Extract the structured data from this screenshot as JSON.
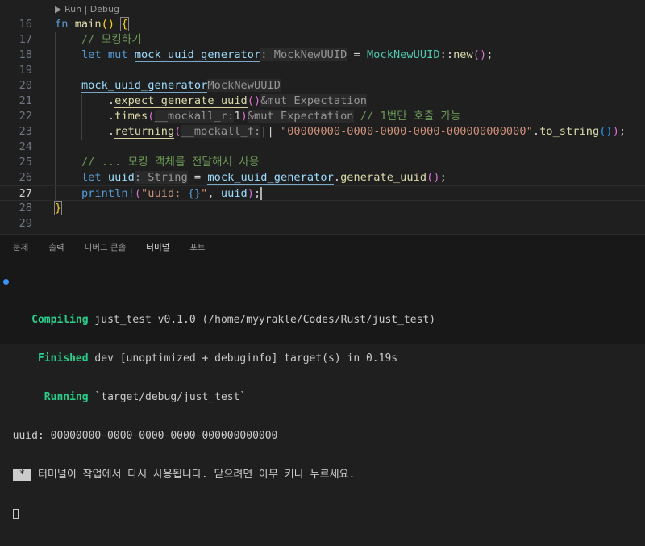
{
  "codelens": {
    "run": "Run",
    "sep": " | ",
    "debug": "Debug"
  },
  "editor": {
    "lines": [
      {
        "n": "16",
        "tokens": [
          [
            "fn ",
            "kw"
          ],
          [
            "main",
            "fn"
          ],
          [
            "()",
            "br1"
          ],
          [
            " ",
            "p"
          ],
          [
            "{",
            "br1 bb"
          ]
        ]
      },
      {
        "n": "17",
        "tokens": [
          [
            "    ",
            "p"
          ],
          [
            "// 모킹하기",
            "cm"
          ]
        ]
      },
      {
        "n": "18",
        "tokens": [
          [
            "    ",
            "p"
          ],
          [
            "let mut ",
            "kw"
          ],
          [
            "mock_uuid_generator",
            "var ul"
          ],
          [
            ": MockNewUUID",
            "hint"
          ],
          [
            " = ",
            "p"
          ],
          [
            "MockNewUUID",
            "ty"
          ],
          [
            "::",
            "p"
          ],
          [
            "new",
            "fn"
          ],
          [
            "()",
            "br2"
          ],
          [
            ";",
            "p"
          ]
        ]
      },
      {
        "n": "19",
        "tokens": []
      },
      {
        "n": "20",
        "tokens": [
          [
            "    ",
            "p"
          ],
          [
            "mock_uuid_generator",
            "var ul"
          ],
          [
            "MockNewUUID",
            "hint"
          ]
        ]
      },
      {
        "n": "21",
        "tokens": [
          [
            "        .",
            "p"
          ],
          [
            "expect_generate_uuid",
            "fn ulm"
          ],
          [
            "()",
            "br2"
          ],
          [
            "&mut Expectation",
            "hint"
          ]
        ]
      },
      {
        "n": "22",
        "tokens": [
          [
            "        .",
            "p"
          ],
          [
            "times",
            "fn ulm"
          ],
          [
            "(",
            "br2"
          ],
          [
            "__mockall_r:",
            "hint"
          ],
          [
            "1",
            "p"
          ],
          [
            ")",
            "br2"
          ],
          [
            "&mut Expectation",
            "hint"
          ],
          [
            " // 1번만 호출 가능",
            "cm"
          ]
        ]
      },
      {
        "n": "23",
        "tokens": [
          [
            "        .",
            "p"
          ],
          [
            "returning",
            "fn ulm"
          ],
          [
            "(",
            "br2"
          ],
          [
            "__mockall_f:",
            "hint"
          ],
          [
            "|| ",
            "p"
          ],
          [
            "\"00000000-0000-0000-0000-000000000000\"",
            "str"
          ],
          [
            ".",
            "p"
          ],
          [
            "to_string",
            "fn"
          ],
          [
            "()",
            "br3"
          ],
          [
            ")",
            "br2"
          ],
          [
            ";",
            "p"
          ]
        ]
      },
      {
        "n": "24",
        "tokens": []
      },
      {
        "n": "25",
        "tokens": [
          [
            "    ",
            "p"
          ],
          [
            "// ... 모킹 객체를 전달해서 사용",
            "cm"
          ]
        ]
      },
      {
        "n": "26",
        "tokens": [
          [
            "    ",
            "p"
          ],
          [
            "let ",
            "kw"
          ],
          [
            "uuid",
            "var"
          ],
          [
            ": String",
            "hint"
          ],
          [
            " = ",
            "p"
          ],
          [
            "mock_uuid_generator",
            "var ul"
          ],
          [
            ".",
            "p"
          ],
          [
            "generate_uuid",
            "fn"
          ],
          [
            "()",
            "br2"
          ],
          [
            ";",
            "p"
          ]
        ]
      },
      {
        "n": "27",
        "tokens": [
          [
            "    ",
            "p"
          ],
          [
            "println!",
            "kw"
          ],
          [
            "(",
            "br2"
          ],
          [
            "\"uuid: ",
            "str"
          ],
          [
            "{}",
            "kw"
          ],
          [
            "\"",
            "str"
          ],
          [
            ", ",
            "p"
          ],
          [
            "uuid",
            "var"
          ],
          [
            ")",
            "br2"
          ],
          [
            ";",
            "p caret"
          ]
        ]
      },
      {
        "n": "28",
        "tokens": [
          [
            "}",
            "br1 bb"
          ]
        ]
      },
      {
        "n": "29",
        "tokens": []
      }
    ]
  },
  "panel": {
    "tabs": [
      "문제",
      "출력",
      "디버그 콘솔",
      "터미널",
      "포트"
    ],
    "active_tab": 3
  },
  "terminal": {
    "compiling_label": "Compiling",
    "compiling_text": " just_test v0.1.0 (/home/myyrakle/Codes/Rust/just_test)",
    "finished_label": "Finished",
    "finished_text": " dev [unoptimized + debuginfo] target(s) in 0.19s",
    "running_label": "Running",
    "running_text": " `target/debug/just_test`",
    "output": "uuid: 00000000-0000-0000-0000-000000000000",
    "star": " * ",
    "reuse_msg": " 터미널이 작업에서 다시 사용됩니다. 닫으려면 아무 키나 누르세요."
  }
}
